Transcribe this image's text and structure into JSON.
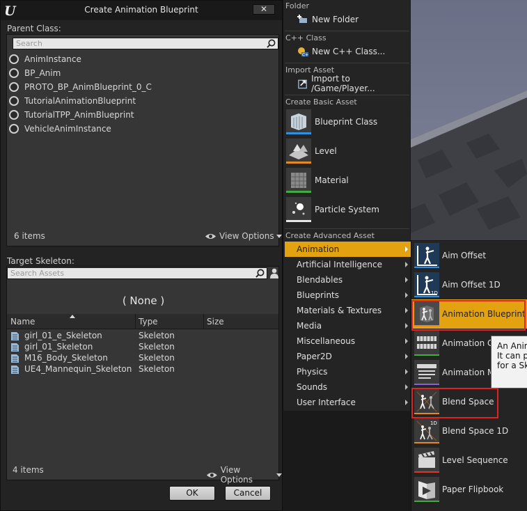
{
  "dialog": {
    "title": "Create Animation Blueprint",
    "close_glyph": "✕",
    "parent_class_label": "Parent Class:",
    "search_placeholder": "Search",
    "classes": [
      "AnimInstance",
      "BP_Anim",
      "PROTO_BP_AnimBlueprint_0_C",
      "TutorialAnimationBlueprint",
      "TutorialTPP_AnimBlueprint",
      "VehicleAnimInstance"
    ],
    "class_count": "6 items",
    "view_options": "View Options",
    "target_skeleton_label": "Target Skeleton:",
    "skeleton_search_placeholder": "Search Assets",
    "none_label": "( None )",
    "columns": {
      "name": "Name",
      "type": "Type",
      "size": "Size"
    },
    "skeletons": [
      {
        "name": "girl_01_e_Skeleton",
        "type": "Skeleton"
      },
      {
        "name": "girl_01_Skeleton",
        "type": "Skeleton"
      },
      {
        "name": "M16_Body_Skeleton",
        "type": "Skeleton"
      },
      {
        "name": "UE4_Mannequin_Skeleton",
        "type": "Skeleton"
      }
    ],
    "skeleton_count": "4 items",
    "skeleton_view_options": "View Options",
    "ok_label": "OK",
    "cancel_label": "Cancel"
  },
  "menu": {
    "folder_header": "Folder",
    "new_folder": "New Folder",
    "cpp_header": "C++ Class",
    "new_cpp": "New C++ Class...",
    "import_header": "Import Asset",
    "import_item": "Import to /Game/Player...",
    "basic_header": "Create Basic Asset",
    "basic_items": [
      {
        "label": "Blueprint Class",
        "icon": "blueprint-class-icon",
        "accent": "#2f8fe0"
      },
      {
        "label": "Level",
        "icon": "level-icon",
        "accent": "#e58a1c"
      },
      {
        "label": "Material",
        "icon": "material-icon",
        "accent": "#3fae3f"
      },
      {
        "label": "Particle System",
        "icon": "particle-system-icon",
        "accent": "#e6e6e6"
      }
    ],
    "advanced_header": "Create Advanced Asset",
    "categories": [
      "Animation",
      "Artificial Intelligence",
      "Blendables",
      "Blueprints",
      "Materials & Textures",
      "Media",
      "Miscellaneous",
      "Paper2D",
      "Physics",
      "Sounds",
      "User Interface"
    ],
    "selected_category": "Animation"
  },
  "submenu": {
    "items": [
      {
        "label": "Aim Offset",
        "icon": "aim-offset-icon"
      },
      {
        "label": "Aim Offset 1D",
        "icon": "aim-offset-1d-icon"
      },
      {
        "label": "Animation Blueprint",
        "icon": "animation-blueprint-icon"
      },
      {
        "label": "Animation Co",
        "icon": "animation-composite-icon"
      },
      {
        "label": "Animation M",
        "icon": "animation-montage-icon"
      },
      {
        "label": "Blend Space",
        "icon": "blend-space-icon"
      },
      {
        "label": "Blend Space 1D",
        "icon": "blend-space-1d-icon"
      },
      {
        "label": "Level Sequence",
        "icon": "level-sequence-icon"
      },
      {
        "label": "Paper Flipbook",
        "icon": "paper-flipbook-icon"
      }
    ],
    "selected": "Animation Blueprint",
    "highlighted": [
      "Animation Blueprint",
      "Blend Space"
    ]
  },
  "tooltip": {
    "lines": [
      "An Anim",
      "It can pe",
      "for a Sk"
    ]
  },
  "colors": {
    "accent": "#e3a20f",
    "highlight_box": "#e02424"
  }
}
